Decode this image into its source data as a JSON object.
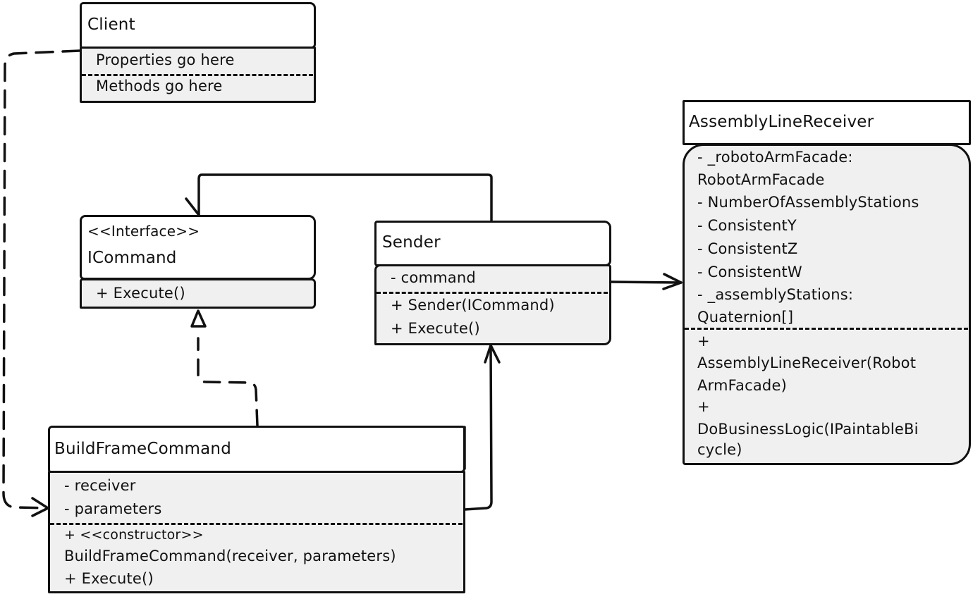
{
  "diagram": {
    "type": "UML class diagram",
    "classes": {
      "client": {
        "name": "Client",
        "attributes": [
          "Properties go here"
        ],
        "methods": [
          "Methods go here"
        ]
      },
      "icommand": {
        "stereotype": "<<Interface>>",
        "name": "ICommand",
        "methods": [
          "+ Execute()"
        ]
      },
      "sender": {
        "name": "Sender",
        "attributes": [
          "- command"
        ],
        "methods": [
          "+ Sender(ICommand)",
          "+ Execute()"
        ]
      },
      "receiver": {
        "name": "AssemblyLineReceiver",
        "attributes": [
          "- _robotoArmFacade:",
          "RobotArmFacade",
          "- NumberOfAssemblyStations",
          "- ConsistentY",
          "- ConsistentZ",
          "- ConsistentW",
          "- _assemblyStations:",
          "Quaternion[]"
        ],
        "methods": [
          "+",
          "AssemblyLineReceiver(Robot",
          "ArmFacade)",
          "+",
          "DoBusinessLogic(IPaintableBi",
          "cycle)"
        ]
      },
      "buildframe": {
        "name": "BuildFrameCommand",
        "attributes": [
          "- receiver",
          "- parameters"
        ],
        "methods": [
          "+ <<constructor>>",
          "BuildFrameCommand(receiver, parameters)",
          "+ Execute()"
        ]
      }
    },
    "relations": [
      {
        "from": "Client",
        "to": "BuildFrameCommand",
        "kind": "dependency"
      },
      {
        "from": "Sender",
        "to": "ICommand",
        "kind": "association"
      },
      {
        "from": "Sender",
        "to": "AssemblyLineReceiver",
        "kind": "association"
      },
      {
        "from": "BuildFrameCommand",
        "to": "ICommand",
        "kind": "realization"
      },
      {
        "from": "BuildFrameCommand",
        "to": "Sender",
        "kind": "association"
      }
    ]
  }
}
